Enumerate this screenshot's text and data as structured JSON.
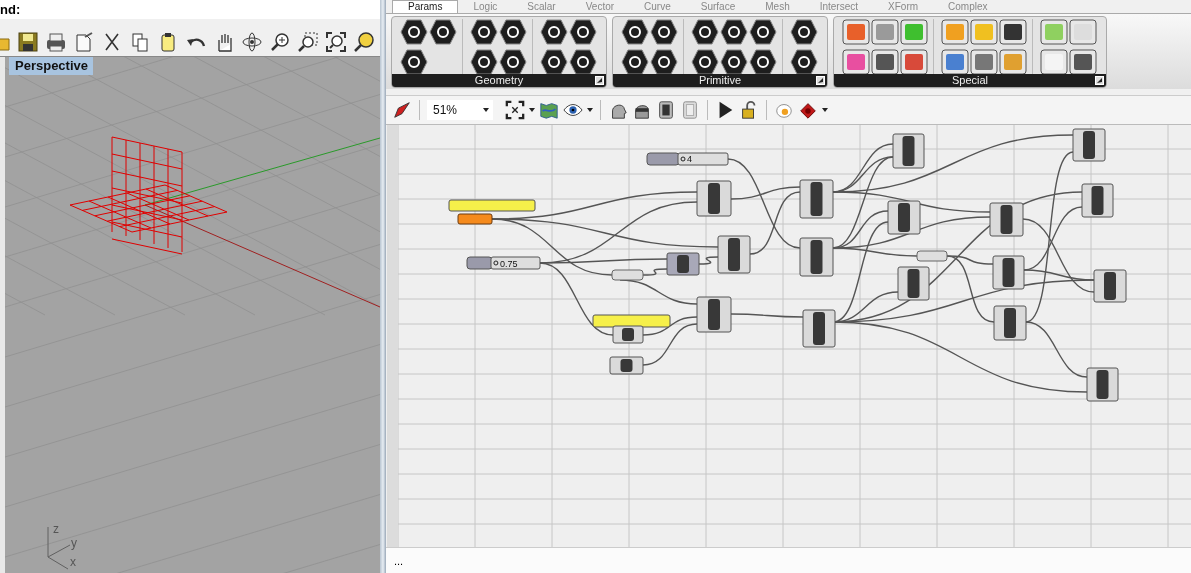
{
  "rhino": {
    "command_prompt": "nd:",
    "viewport": {
      "title": "Perspective",
      "axes": [
        "z",
        "y",
        "x"
      ]
    }
  },
  "grasshopper": {
    "tabs": [
      {
        "label": "Params",
        "selected": true
      },
      {
        "label": "Logic",
        "selected": false
      },
      {
        "label": "Scalar",
        "selected": false
      },
      {
        "label": "Vector",
        "selected": false
      },
      {
        "label": "Curve",
        "selected": false
      },
      {
        "label": "Surface",
        "selected": false
      },
      {
        "label": "Mesh",
        "selected": false
      },
      {
        "label": "Intersect",
        "selected": false
      },
      {
        "label": "XForm",
        "selected": false
      },
      {
        "label": "Complex",
        "selected": false
      }
    ],
    "panels": [
      {
        "title": "Geometry",
        "kind": "hex"
      },
      {
        "title": "Primitive",
        "kind": "hex"
      },
      {
        "title": "Special",
        "kind": "square"
      }
    ],
    "toolbar": {
      "zoom": "51%"
    },
    "canvas": {
      "sliders": [
        {
          "value": "4",
          "level": 0.1
        },
        {
          "value": "0.75",
          "level": 0.1
        }
      ]
    },
    "status_bar": "..."
  }
}
